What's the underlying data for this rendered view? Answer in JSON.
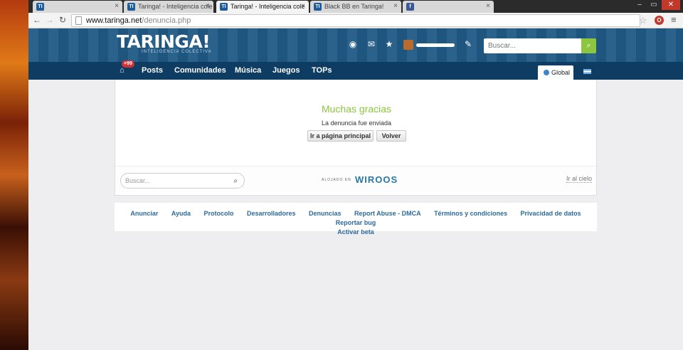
{
  "browser": {
    "tabs": [
      {
        "favicon": "TI",
        "title": "",
        "active": false
      },
      {
        "favicon": "TI",
        "title": "Taringa! - Inteligencia cole",
        "active": false
      },
      {
        "favicon": "TI",
        "title": "Taringa! - Inteligencia cole",
        "active": true
      },
      {
        "favicon": "TI",
        "title": "Black BB en Taringa!",
        "active": false
      },
      {
        "favicon": "f",
        "title": "",
        "active": false
      }
    ],
    "url_host": "www.taringa.net",
    "url_path": "/denuncia.php",
    "window_buttons": [
      "–",
      "▭",
      "✕"
    ]
  },
  "header": {
    "logo": "TARINGA!",
    "slogan": "INTELIGENCIA COLECTIVA",
    "search_placeholder": "Buscar..."
  },
  "nav": {
    "badge": "+99",
    "links": [
      "Posts",
      "Comunidades",
      "Música",
      "Juegos",
      "TOPs"
    ],
    "global_label": "Global"
  },
  "main": {
    "title": "Muchas gracias",
    "message": "La denuncia fue enviada",
    "btn_home": "Ir a página principal",
    "btn_back": "Volver"
  },
  "card_footer": {
    "search_placeholder": "Buscar...",
    "hosted_label": "ALOJADO EN",
    "hosted_brand": "WIROOS",
    "to_top": "Ir al cielo"
  },
  "footer_links": [
    "Anunciar",
    "Ayuda",
    "Protocolo",
    "Desarrolladores",
    "Denuncias",
    "Report Abuse - DMCA",
    "Términos y condiciones",
    "Privacidad de datos",
    "Reportar bug",
    "Activar beta"
  ]
}
